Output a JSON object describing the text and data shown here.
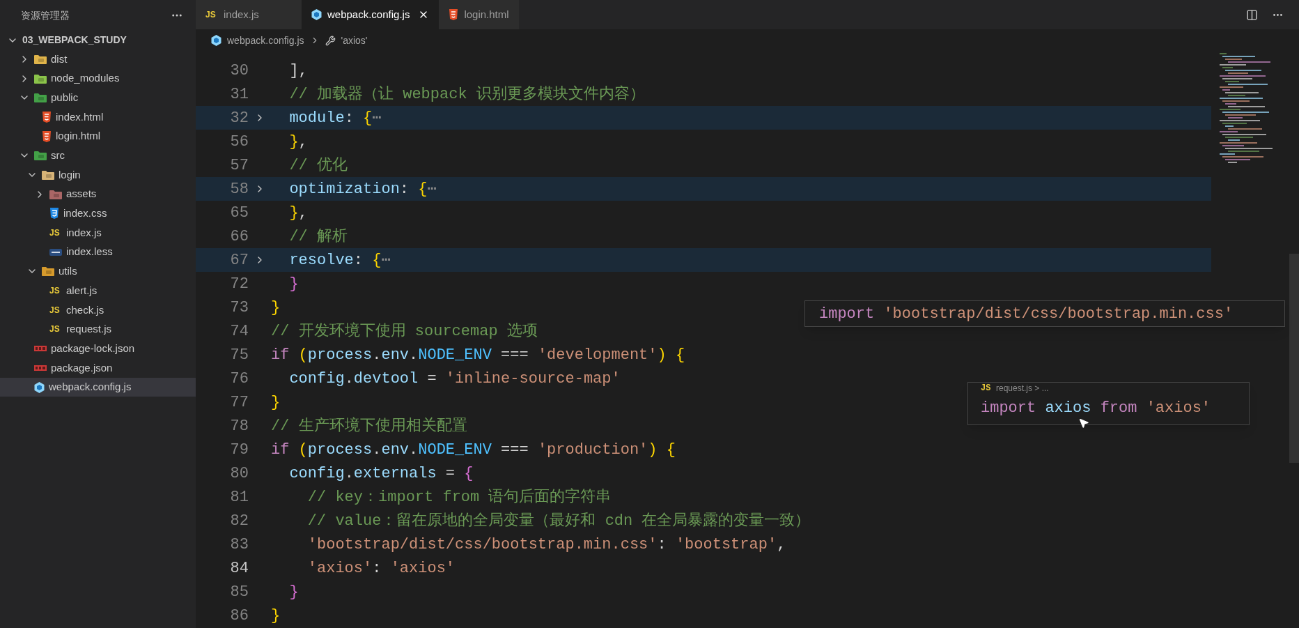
{
  "explorer": {
    "title": "资源管理器",
    "root": {
      "label": "03_WEBPACK_STUDY",
      "expanded": true,
      "children": [
        {
          "label": "dist",
          "kind": "dist",
          "expanded": false,
          "selected": false
        },
        {
          "label": "node_modules",
          "kind": "node",
          "expanded": false,
          "selected": false
        },
        {
          "label": "public",
          "kind": "public",
          "expanded": true,
          "selected": false,
          "children": [
            {
              "label": "index.html",
              "kind": "html",
              "selected": false
            },
            {
              "label": "login.html",
              "kind": "html",
              "selected": false
            }
          ]
        },
        {
          "label": "src",
          "kind": "src",
          "expanded": true,
          "selected": false,
          "children": [
            {
              "label": "login",
              "kind": "plain",
              "expanded": true,
              "selected": false,
              "children": [
                {
                  "label": "assets",
                  "kind": "assets",
                  "expanded": false,
                  "selected": false
                },
                {
                  "label": "index.css",
                  "kind": "css",
                  "selected": false
                },
                {
                  "label": "index.js",
                  "kind": "js",
                  "badge": "JS",
                  "selected": false
                },
                {
                  "label": "index.less",
                  "kind": "less",
                  "selected": false
                }
              ]
            },
            {
              "label": "utils",
              "kind": "utils",
              "expanded": true,
              "selected": false,
              "children": [
                {
                  "label": "alert.js",
                  "kind": "js",
                  "badge": "JS",
                  "selected": false
                },
                {
                  "label": "check.js",
                  "kind": "js",
                  "badge": "JS",
                  "selected": false
                },
                {
                  "label": "request.js",
                  "kind": "js",
                  "badge": "JS",
                  "selected": false
                }
              ]
            }
          ]
        },
        {
          "label": "package-lock.json",
          "kind": "npm",
          "selected": false
        },
        {
          "label": "package.json",
          "kind": "npm",
          "selected": false
        },
        {
          "label": "webpack.config.js",
          "kind": "webpack",
          "selected": true
        }
      ]
    }
  },
  "tabs": [
    {
      "label": "index.js",
      "kind": "js",
      "badge": "JS",
      "selected": false
    },
    {
      "label": "webpack.config.js",
      "kind": "webpack",
      "selected": true
    },
    {
      "label": "login.html",
      "kind": "html",
      "selected": false
    }
  ],
  "breadcrumb": [
    {
      "label": "webpack.config.js",
      "kind": "webpack"
    },
    {
      "label": "'axios'",
      "kind": "symbol"
    }
  ],
  "code": {
    "lines": [
      {
        "number": "30",
        "folded": false,
        "current": false,
        "tokens": [
          {
            "kind": "p",
            "text": "  ],"
          }
        ]
      },
      {
        "number": "31",
        "folded": false,
        "current": false,
        "tokens": [
          {
            "kind": "c",
            "text": "  // 加载器（让 webpack 识别更多模块文件内容）"
          }
        ]
      },
      {
        "number": "32",
        "folded": true,
        "current": false,
        "tokens": [
          {
            "kind": "v",
            "text": "  module"
          },
          {
            "kind": "p",
            "text": ": "
          },
          {
            "kind": "b1",
            "text": "{"
          },
          {
            "kind": "e",
            "text": "⋯"
          }
        ]
      },
      {
        "number": "56",
        "folded": false,
        "current": false,
        "tokens": [
          {
            "kind": "b1",
            "text": "  }"
          },
          {
            "kind": "p",
            "text": ","
          }
        ]
      },
      {
        "number": "57",
        "folded": false,
        "current": false,
        "tokens": [
          {
            "kind": "c",
            "text": "  // 优化"
          }
        ]
      },
      {
        "number": "58",
        "folded": true,
        "current": false,
        "tokens": [
          {
            "kind": "v",
            "text": "  optimization"
          },
          {
            "kind": "p",
            "text": ": "
          },
          {
            "kind": "b1",
            "text": "{"
          },
          {
            "kind": "e",
            "text": "⋯"
          }
        ]
      },
      {
        "number": "65",
        "folded": false,
        "current": false,
        "tokens": [
          {
            "kind": "b1",
            "text": "  }"
          },
          {
            "kind": "p",
            "text": ","
          }
        ]
      },
      {
        "number": "66",
        "folded": false,
        "current": false,
        "tokens": [
          {
            "kind": "c",
            "text": "  // 解析"
          }
        ]
      },
      {
        "number": "67",
        "folded": true,
        "current": false,
        "tokens": [
          {
            "kind": "v",
            "text": "  resolve"
          },
          {
            "kind": "p",
            "text": ": "
          },
          {
            "kind": "b1",
            "text": "{"
          },
          {
            "kind": "e",
            "text": "⋯"
          }
        ]
      },
      {
        "number": "72",
        "folded": false,
        "current": false,
        "tokens": [
          {
            "kind": "b2",
            "text": "  }"
          }
        ]
      },
      {
        "number": "73",
        "folded": false,
        "current": false,
        "tokens": [
          {
            "kind": "b1",
            "text": "}"
          }
        ]
      },
      {
        "number": "74",
        "folded": false,
        "current": false,
        "tokens": [
          {
            "kind": "c",
            "text": "// 开发环境下使用 sourcemap 选项"
          }
        ]
      },
      {
        "number": "75",
        "folded": false,
        "current": false,
        "tokens": [
          {
            "kind": "kw",
            "text": "if "
          },
          {
            "kind": "b1",
            "text": "("
          },
          {
            "kind": "v",
            "text": "process"
          },
          {
            "kind": "p",
            "text": "."
          },
          {
            "kind": "v",
            "text": "env"
          },
          {
            "kind": "p",
            "text": "."
          },
          {
            "kind": "const",
            "text": "NODE_ENV"
          },
          {
            "kind": "p",
            "text": " === "
          },
          {
            "kind": "s",
            "text": "'development'"
          },
          {
            "kind": "b1",
            "text": ") {"
          }
        ]
      },
      {
        "number": "76",
        "folded": false,
        "current": false,
        "tokens": [
          {
            "kind": "v",
            "text": "  config"
          },
          {
            "kind": "p",
            "text": "."
          },
          {
            "kind": "v",
            "text": "devtool"
          },
          {
            "kind": "p",
            "text": " = "
          },
          {
            "kind": "s",
            "text": "'inline-source-map'"
          }
        ]
      },
      {
        "number": "77",
        "folded": false,
        "current": false,
        "tokens": [
          {
            "kind": "b1",
            "text": "}"
          }
        ]
      },
      {
        "number": "78",
        "folded": false,
        "current": false,
        "tokens": [
          {
            "kind": "c",
            "text": "// 生产环境下使用相关配置"
          }
        ]
      },
      {
        "number": "79",
        "folded": false,
        "current": false,
        "tokens": [
          {
            "kind": "kw",
            "text": "if "
          },
          {
            "kind": "b1",
            "text": "("
          },
          {
            "kind": "v",
            "text": "process"
          },
          {
            "kind": "p",
            "text": "."
          },
          {
            "kind": "v",
            "text": "env"
          },
          {
            "kind": "p",
            "text": "."
          },
          {
            "kind": "const",
            "text": "NODE_ENV"
          },
          {
            "kind": "p",
            "text": " === "
          },
          {
            "kind": "s",
            "text": "'production'"
          },
          {
            "kind": "b1",
            "text": ") {"
          }
        ]
      },
      {
        "number": "80",
        "folded": false,
        "current": false,
        "tokens": [
          {
            "kind": "v",
            "text": "  config"
          },
          {
            "kind": "p",
            "text": "."
          },
          {
            "kind": "v",
            "text": "externals"
          },
          {
            "kind": "p",
            "text": " = "
          },
          {
            "kind": "b2",
            "text": "{"
          }
        ]
      },
      {
        "number": "81",
        "folded": false,
        "current": false,
        "tokens": [
          {
            "kind": "c",
            "text": "    // key：import from 语句后面的字符串"
          }
        ]
      },
      {
        "number": "82",
        "folded": false,
        "current": false,
        "tokens": [
          {
            "kind": "c",
            "text": "    // value：留在原地的全局变量（最好和 cdn 在全局暴露的变量一致）"
          }
        ]
      },
      {
        "number": "83",
        "folded": false,
        "current": false,
        "tokens": [
          {
            "kind": "s",
            "text": "    'bootstrap/dist/css/bootstrap.min.css'"
          },
          {
            "kind": "p",
            "text": ": "
          },
          {
            "kind": "s",
            "text": "'bootstrap'"
          },
          {
            "kind": "p",
            "text": ","
          }
        ]
      },
      {
        "number": "84",
        "folded": false,
        "current": true,
        "tokens": [
          {
            "kind": "s",
            "text": "    'axios'"
          },
          {
            "kind": "p",
            "text": ": "
          },
          {
            "kind": "s",
            "text": "'axios'"
          }
        ]
      },
      {
        "number": "85",
        "folded": false,
        "current": false,
        "tokens": [
          {
            "kind": "b2",
            "text": "  }"
          }
        ]
      },
      {
        "number": "86",
        "folded": false,
        "current": false,
        "tokens": [
          {
            "kind": "b1",
            "text": "}"
          }
        ]
      }
    ]
  },
  "peeks": [
    {
      "tokens": [
        {
          "kind": "kw",
          "text": "import "
        },
        {
          "kind": "s",
          "text": "'bootstrap/dist/css/bootstrap.min.css'"
        }
      ]
    },
    {
      "badge": "JS",
      "header": "request.js > ...",
      "tokens": [
        {
          "kind": "kw",
          "text": "import "
        },
        {
          "kind": "v",
          "text": "axios"
        },
        {
          "kind": "kw",
          "text": " from "
        },
        {
          "kind": "s",
          "text": "'axios'"
        }
      ]
    }
  ]
}
